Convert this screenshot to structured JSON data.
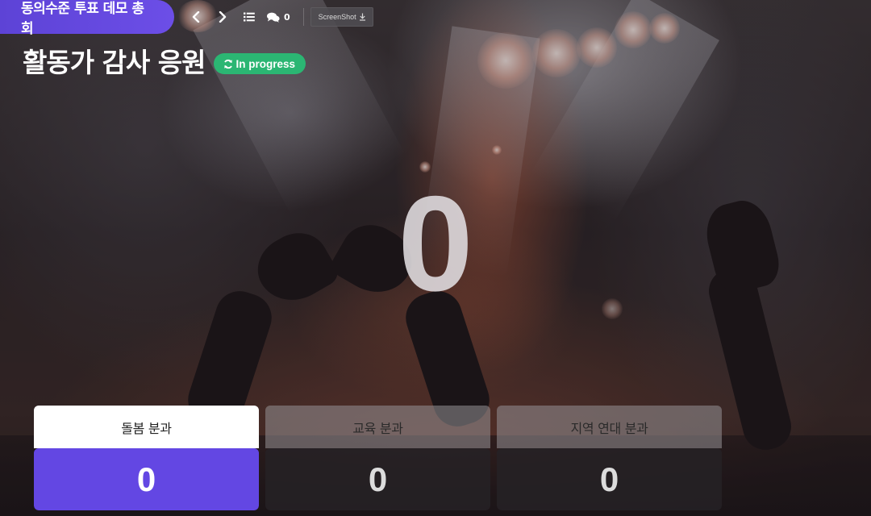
{
  "event": {
    "name": "동의수준 투표 데모 총회"
  },
  "toolbar": {
    "prev_icon": "chevron-left-icon",
    "next_icon": "chevron-right-icon",
    "list_icon": "list-icon",
    "comment_icon": "comments-icon",
    "comment_count": "0",
    "screenshot_label": "ScreenShot",
    "screenshot_icon": "download-icon"
  },
  "poll": {
    "title": "활동가 감사 응원",
    "status_label": "In progress",
    "status_icon": "refresh-icon",
    "total_votes": "0"
  },
  "options": [
    {
      "label": "돌봄 분과",
      "count": "0",
      "selected": true
    },
    {
      "label": "교육 분과",
      "count": "0",
      "selected": false
    },
    {
      "label": "지역 연대 분과",
      "count": "0",
      "selected": false
    }
  ],
  "colors": {
    "accent": "#6347e3",
    "status_green": "#2bb673"
  }
}
